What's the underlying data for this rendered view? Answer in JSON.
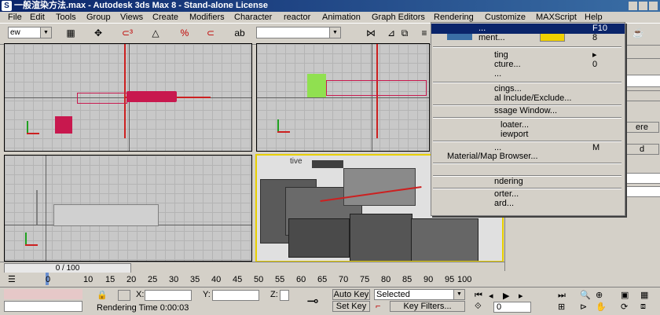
{
  "window": {
    "title": "一般渲染方法.max - Autodesk 3ds Max 8 - Stand-alone License"
  },
  "menu": [
    "File",
    "Edit",
    "Tools",
    "Group",
    "Views",
    "Create",
    "Modifiers",
    "Character",
    "reactor",
    "Animation",
    "Graph Editors",
    "Rendering",
    "Customize",
    "MAXScript",
    "Help"
  ],
  "toolbar": {
    "selection_filter": "ew",
    "named_selection": ""
  },
  "viewports": {
    "perspective_label": "tive"
  },
  "dropdown": {
    "items": [
      {
        "label": "...",
        "shortcut": "F10"
      },
      {
        "label": "ment...",
        "shortcut": "8"
      },
      {
        "label": "ting",
        "shortcut": "▸"
      },
      {
        "label": "cture...",
        "shortcut": "0"
      },
      {
        "label": "...",
        "shortcut": ""
      },
      {
        "label": "cings...",
        "shortcut": ""
      },
      {
        "label": "al Include/Exclude...",
        "shortcut": ""
      },
      {
        "label": "ssage Window...",
        "shortcut": ""
      },
      {
        "label": "loater...",
        "shortcut": ""
      },
      {
        "label": "iewport",
        "shortcut": ""
      },
      {
        "label": "...",
        "shortcut": "M"
      },
      {
        "label": "Material/Map Browser...",
        "shortcut": ""
      },
      {
        "label": "ndering",
        "shortcut": ""
      },
      {
        "label": "orter...",
        "shortcut": ""
      },
      {
        "label": "ard...",
        "shortcut": ""
      }
    ]
  },
  "cmdpanel": {
    "btn_ere": "ere",
    "btn_d": "d"
  },
  "time": {
    "slider": "0 / 100",
    "ticks": [
      "0",
      "10",
      "15",
      "20",
      "25",
      "30",
      "35",
      "40",
      "45",
      "50",
      "55",
      "60",
      "65",
      "70",
      "75",
      "80",
      "85",
      "90",
      "95",
      "100"
    ]
  },
  "status": {
    "x_label": "X:",
    "y_label": "Y:",
    "z_label": "Z:",
    "rendering_time": "Rendering Time  0:00:03",
    "auto_key": "Auto Key",
    "set_key": "Set Key",
    "selected": "Selected",
    "key_filters": "Key Filters...",
    "frame": "0"
  }
}
